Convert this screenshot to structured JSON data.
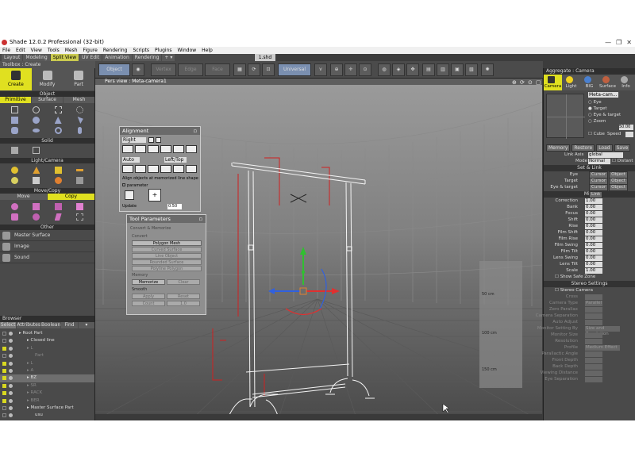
{
  "app": {
    "title": "Shade 12.0.2 Professional (32-bit)",
    "window_controls": [
      "—",
      "❐",
      "✕"
    ]
  },
  "menu": [
    "File",
    "Edit",
    "View",
    "Tools",
    "Mesh",
    "Figure",
    "Rendering",
    "Scripts",
    "Plugins",
    "Window",
    "Help"
  ],
  "workspace_tabs": [
    {
      "label": "Layout",
      "active": false
    },
    {
      "label": "Modeling",
      "active": false
    },
    {
      "label": "Split View",
      "active": true
    },
    {
      "label": "UV Edit",
      "active": false
    },
    {
      "label": "Animation",
      "active": false
    },
    {
      "label": "Rendering",
      "active": false
    },
    {
      "label": "+ ▾",
      "active": false
    }
  ],
  "document_tab": "1.shd",
  "toolbar": {
    "object_btn": "Object",
    "universal_btn": "Universal",
    "dim_btns": [
      "Vertex",
      "Edge",
      "Face"
    ]
  },
  "toolbox": {
    "header": "Toolbox : Create",
    "tabs": [
      "Create",
      "Modify",
      "Part"
    ],
    "object_section": "Object",
    "object_subtabs": [
      "Primitive",
      "Surface",
      "Mesh"
    ],
    "solid_section": "Solid",
    "lightcam_section": "Light/Camera",
    "movecopy_section": "Move/Copy",
    "movecopy_subtabs": [
      "Move",
      "Copy"
    ],
    "other_section": "Other",
    "other_items": [
      "Master Surface",
      "Image",
      "Sound"
    ]
  },
  "browser": {
    "header": "Browser",
    "tabs": [
      "Select",
      "Attributes",
      "Boolean",
      "Find",
      "▾"
    ],
    "tree": [
      {
        "label": "Root Part",
        "depth": 0,
        "checked": false,
        "selected": false,
        "dim": false
      },
      {
        "label": "Closed line",
        "depth": 1,
        "checked": false,
        "selected": false,
        "dim": false
      },
      {
        "label": "L",
        "depth": 1,
        "checked": true,
        "selected": false,
        "dim": true
      },
      {
        "label": "Part",
        "depth": 2,
        "checked": false,
        "selected": false,
        "dim": true
      },
      {
        "label": "L",
        "depth": 1,
        "checked": true,
        "selected": false,
        "dim": true
      },
      {
        "label": "A",
        "depth": 1,
        "checked": true,
        "selected": false,
        "dim": true
      },
      {
        "label": "BZ",
        "depth": 1,
        "checked": true,
        "selected": true,
        "dim": false
      },
      {
        "label": "SR",
        "depth": 1,
        "checked": true,
        "selected": false,
        "dim": true
      },
      {
        "label": "RACK",
        "depth": 1,
        "checked": true,
        "selected": false,
        "dim": true
      },
      {
        "label": "BER",
        "depth": 1,
        "checked": true,
        "selected": false,
        "dim": true
      },
      {
        "label": "Master Surface Part",
        "depth": 1,
        "checked": false,
        "selected": false,
        "dim": false
      },
      {
        "label": "usu",
        "depth": 2,
        "checked": false,
        "selected": false,
        "dim": false
      },
      {
        "label": "s",
        "depth": 2,
        "checked": false,
        "selected": false,
        "dim": false
      }
    ]
  },
  "viewport": {
    "title": "Pers view : Meta-camera1",
    "ruler_labels": [
      "50 cm",
      "100 cm",
      "150 cm"
    ],
    "axis_label": "global"
  },
  "alignment": {
    "title": "Alignment",
    "mode": "Right",
    "auto_label": "Auto",
    "lefttop_label": "Left/Top",
    "hint": "Align objects at memorized line shape",
    "parameter_label": "parameter",
    "update_label": "Update",
    "value": "0.50"
  },
  "tool_params": {
    "title": "Tool Parameters",
    "group_title": "Convert & Memorize",
    "convert_label": "Convert",
    "buttons": [
      "Polygon Mesh",
      "Curved Surface",
      "Line Object",
      "Rounded Surface",
      "Polyline Polygon"
    ],
    "memory_label": "Memory",
    "memorize": "Memorize",
    "clear": "Clear",
    "smooth_label": "Smooth",
    "smooth_buttons": [
      "Apply",
      "Reset",
      "Count",
      "1.0"
    ]
  },
  "camera": {
    "header": "Aggregate : Camera",
    "tabs": [
      "Camera",
      "Light",
      "BIG",
      "Surface",
      "Info"
    ],
    "camera_name": "Meta-cam...",
    "radio": [
      "Eye",
      "Target",
      "Eye & target",
      "Zoom"
    ],
    "zoom_value": "50.00",
    "cube_label": "Cube",
    "speed_label": "Speed",
    "memory_buttons": [
      "Memory",
      "Restore",
      "Load",
      "Save"
    ],
    "link_label": "Link Axis",
    "link_value": "global",
    "mode_label": "Mode",
    "mode_value": "Normal",
    "distant_label": "Distant",
    "setlink_section": "Set & Link",
    "setlink_rows": [
      {
        "label": "Eye",
        "btns": [
          "Cursor",
          "Object",
          "Link"
        ]
      },
      {
        "label": "Target",
        "btns": [
          "Cursor",
          "Object",
          "Link"
        ]
      },
      {
        "label": "Eye & target",
        "btns": [
          "Cursor",
          "Object",
          "Link"
        ]
      }
    ],
    "misc_section": "Misc",
    "misc_rows": [
      {
        "label": "Correction",
        "value": "1.00",
        "dim": false
      },
      {
        "label": "Bank",
        "value": "0.00",
        "dim": false
      },
      {
        "label": "Focus",
        "value": "0.00",
        "dim": false
      },
      {
        "label": "Shift",
        "value": "0.00",
        "dim": false
      },
      {
        "label": "Rise",
        "value": "0.00",
        "dim": false
      },
      {
        "label": "Film Shift",
        "value": "0.00",
        "dim": false
      },
      {
        "label": "Film Rise",
        "value": "0.00",
        "dim": false
      },
      {
        "label": "Film Swing",
        "value": "0.00",
        "dim": false
      },
      {
        "label": "Film Tilt",
        "value": "0.00",
        "dim": false
      },
      {
        "label": "Lens Swing",
        "value": "0.00",
        "dim": false
      },
      {
        "label": "Lens Tilt",
        "value": "0.00",
        "dim": false
      },
      {
        "label": "Scale",
        "value": "1.00",
        "dim": false
      }
    ],
    "safezone_label": "Show Safe Zone",
    "stereo_section": "Stereo Settings",
    "stereo_label": "Stereo Camera",
    "stereo_rows": [
      {
        "label": "Cross",
        "value": "",
        "dim": true
      },
      {
        "label": "Camera Type",
        "value": "Parallel",
        "dim": true
      },
      {
        "label": "Zero Parallax",
        "value": "",
        "dim": true
      },
      {
        "label": "Camera Separation",
        "value": "",
        "dim": true
      },
      {
        "label": "Auto Adjust",
        "value": "",
        "dim": true
      },
      {
        "label": "Monitor Setting By",
        "value": "Size and Resolution",
        "dim": true
      },
      {
        "label": "Monitor Size",
        "value": "",
        "dim": true
      },
      {
        "label": "Resolution",
        "value": "",
        "dim": true
      },
      {
        "label": "Profile",
        "value": "Medium Effect",
        "dim": true
      },
      {
        "label": "Parallactic Angle",
        "value": "",
        "dim": true
      },
      {
        "label": "Front Depth",
        "value": "",
        "dim": true
      },
      {
        "label": "Back Depth",
        "value": "",
        "dim": true
      },
      {
        "label": "Viewing Distance",
        "value": "",
        "dim": true
      },
      {
        "label": "Eye Separation",
        "value": "",
        "dim": true
      }
    ]
  },
  "colors": {
    "accent": "#e0e020",
    "panel_bg": "#4a4a4a",
    "viewport_bg": "#707070",
    "wire": "#ffffff",
    "axis_x": "#e03030",
    "axis_y": "#30c030",
    "axis_z": "#3060e0"
  }
}
